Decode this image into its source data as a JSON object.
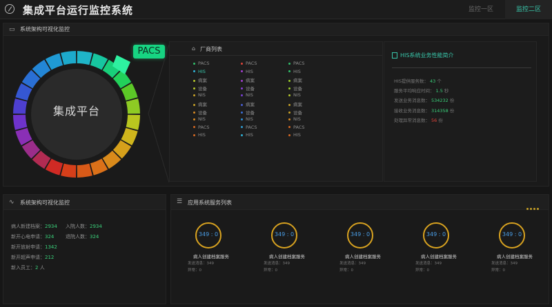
{
  "header": {
    "title": "集成平台运行监控系统",
    "tabs": [
      {
        "label": "监控一区",
        "active": false
      },
      {
        "label": "监控二区",
        "active": true
      }
    ],
    "accent": "#39c8ac"
  },
  "architecture": {
    "title": "系统架构可视化监控",
    "hub_label": "集成平台",
    "selected_tag": "PACS"
  },
  "vendors": {
    "title": "厂商列表",
    "columns": [
      [
        {
          "name": "PACS",
          "color": "#31c06b",
          "highlight": false
        },
        {
          "name": "HIS",
          "color": "#2fb2d8",
          "highlight": true
        },
        {
          "name": "病案",
          "color": "#b6c82c",
          "highlight": false
        },
        {
          "name": "设备",
          "color": "#b6c82c",
          "highlight": false
        },
        {
          "name": "NIS",
          "color": "#c9a227",
          "highlight": false
        },
        {
          "name": "病案",
          "color": "#c9a227",
          "highlight": false
        },
        {
          "name": "设备",
          "color": "#d88a22",
          "highlight": false
        },
        {
          "name": "NIS",
          "color": "#d88a22",
          "highlight": false
        },
        {
          "name": "PACS",
          "color": "#d86a22",
          "highlight": false
        },
        {
          "name": "HIS",
          "color": "#d86a22",
          "highlight": false
        }
      ],
      [
        {
          "name": "PACS",
          "color": "#e0443a",
          "highlight": false
        },
        {
          "name": "HIS",
          "color": "#a23fd0",
          "highlight": false
        },
        {
          "name": "病案",
          "color": "#a23fd0",
          "highlight": false
        },
        {
          "name": "设备",
          "color": "#8a3fd8",
          "highlight": false
        },
        {
          "name": "NIS",
          "color": "#7a3fd8",
          "highlight": false
        },
        {
          "name": "病案",
          "color": "#4a5fd8",
          "highlight": false
        },
        {
          "name": "设备",
          "color": "#3a6fd8",
          "highlight": false
        },
        {
          "name": "NIS",
          "color": "#2f8fd8",
          "highlight": false
        },
        {
          "name": "PACS",
          "color": "#2fa0d8",
          "highlight": false
        },
        {
          "name": "HIS",
          "color": "#2fb2d8",
          "highlight": false
        }
      ],
      [
        {
          "name": "PACS",
          "color": "#31c06b",
          "highlight": false
        },
        {
          "name": "HIS",
          "color": "#31c06b",
          "highlight": false
        },
        {
          "name": "病案",
          "color": "#9acc2a",
          "highlight": false
        },
        {
          "name": "设备",
          "color": "#9acc2a",
          "highlight": false
        },
        {
          "name": "NIS",
          "color": "#b6c82c",
          "highlight": false
        },
        {
          "name": "病案",
          "color": "#c9a227",
          "highlight": false
        },
        {
          "name": "设备",
          "color": "#c9a227",
          "highlight": false
        },
        {
          "name": "NIS",
          "color": "#d88a22",
          "highlight": false
        },
        {
          "name": "PACS",
          "color": "#d86a22",
          "highlight": false
        },
        {
          "name": "HIS",
          "color": "#d86a22",
          "highlight": false
        }
      ]
    ]
  },
  "his_perf": {
    "title": "HIS系统业务性能简介",
    "stats": [
      {
        "label": "HIS提供服务数：",
        "value": "43",
        "unit": "个",
        "value_color": "#3ad07a"
      },
      {
        "label": "服务平均响应时间：",
        "value": "1.5",
        "unit": "秒",
        "value_color": "#3ad07a"
      },
      {
        "label": "发送业务消息数：",
        "value": "534232",
        "unit": "份",
        "value_color": "#3ad07a"
      },
      {
        "label": "接收业务消息数：",
        "value": "314358",
        "unit": "份",
        "value_color": "#3ad07a"
      },
      {
        "label": "处理异常消息数：",
        "value": "56",
        "unit": "份",
        "value_color": "#e0443a"
      }
    ]
  },
  "bottom_left": {
    "title": "系统架构可视化监控",
    "rows": [
      [
        {
          "label": "病人新建档案：",
          "value": "2934"
        },
        {
          "label": "入院人数：",
          "value": "2934"
        }
      ],
      [
        {
          "label": "新开心电申请：",
          "value": "324"
        },
        {
          "label": "退院人数：",
          "value": "324"
        }
      ],
      [
        {
          "label": "新开放射申请：",
          "value": "1342"
        }
      ],
      [
        {
          "label": "新开超声申请：",
          "value": "212"
        }
      ],
      [
        {
          "label": "新入员工：",
          "value": "2",
          "unit": "人"
        }
      ]
    ]
  },
  "services": {
    "title": "应用系统服务列表",
    "items": [
      {
        "gauge": "349 : 0",
        "name": "病人创建档案服务",
        "sent": "发送消息：349",
        "error": "异常：0"
      },
      {
        "gauge": "349 : 0",
        "name": "病人创建档案服务",
        "sent": "发送消息：349",
        "error": "异常：0"
      },
      {
        "gauge": "349 : 0",
        "name": "病人创建档案服务",
        "sent": "发送消息：349",
        "error": "异常：0"
      },
      {
        "gauge": "349 : 0",
        "name": "病人创建档案服务",
        "sent": "发送消息：349",
        "error": "异常：0"
      },
      {
        "gauge": "349 : 0",
        "name": "病人创建档案服务",
        "sent": "发送消息：349",
        "error": "异常：0"
      }
    ]
  }
}
